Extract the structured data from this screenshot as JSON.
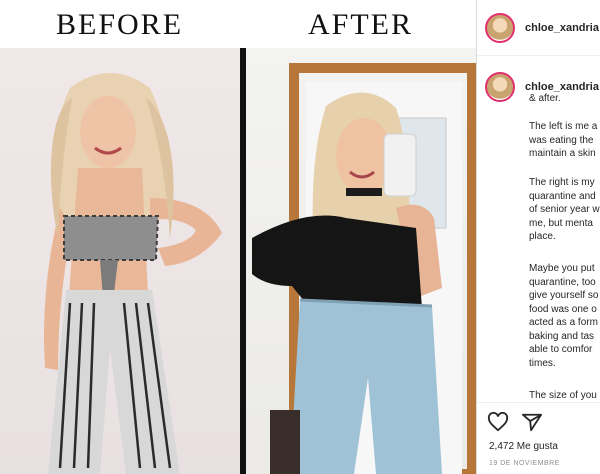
{
  "photo": {
    "before_label": "BEFORE",
    "after_label": "AFTER"
  },
  "post": {
    "username": "chloe_xandria",
    "caption_username": "chloe_xandria",
    "caption_line2": "& after.",
    "paragraphs": [
      [
        "The left is me a",
        "was eating the",
        "maintain a skin"
      ],
      [
        "The right is my",
        "quarantine and",
        "of senior year w",
        "me, but menta",
        "place."
      ],
      [
        "Maybe you put",
        "quarantine, too",
        "give yourself so",
        "food was one o",
        "acted as a form",
        "baking and tas",
        "able to comfor",
        "times."
      ],
      [
        "The size of you"
      ]
    ],
    "likes": "2,472 Me gusta",
    "date": "19 DE NOVIEMBRE"
  },
  "icons": {
    "like": "heart-icon",
    "share": "send-icon"
  }
}
